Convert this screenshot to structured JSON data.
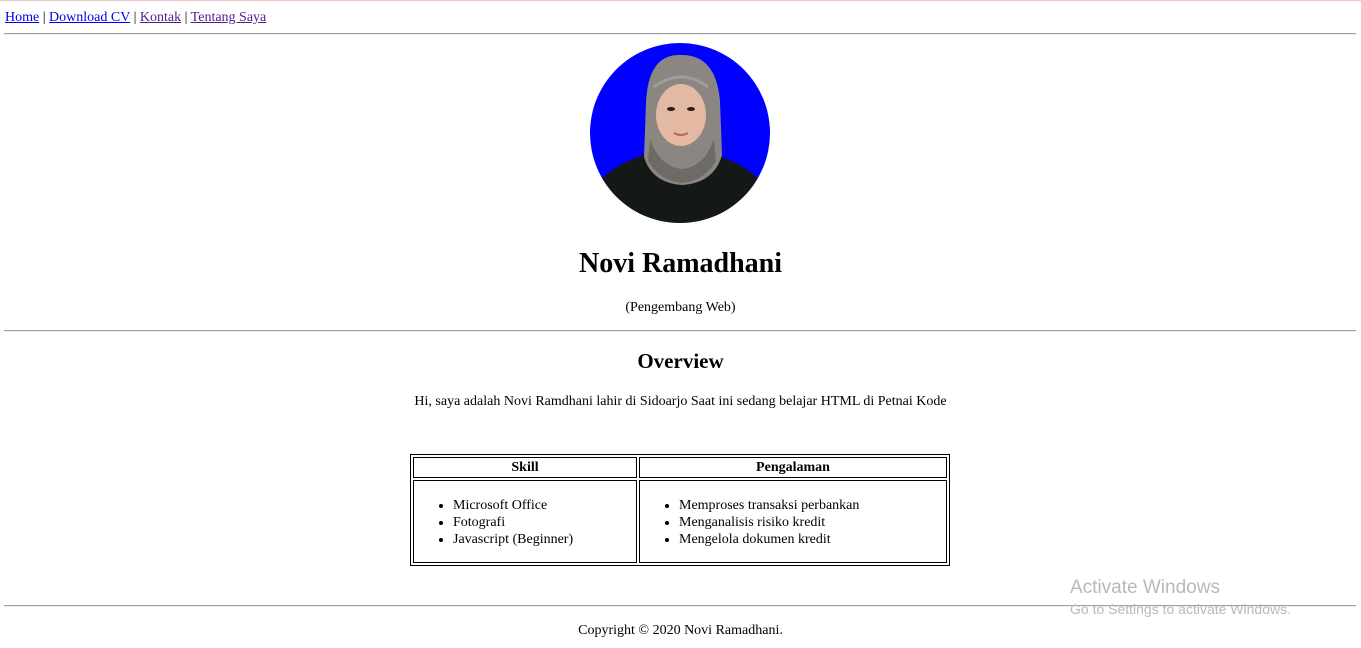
{
  "nav": {
    "links": [
      {
        "label": "Home"
      },
      {
        "label": "Download CV"
      },
      {
        "label": "Kontak"
      },
      {
        "label": "Tentang Saya"
      }
    ],
    "separator": "|"
  },
  "profile": {
    "name": "Novi Ramadhani",
    "role": "(Pengembang Web)",
    "photo_background": "#0000fe"
  },
  "overview": {
    "title": "Overview",
    "text": "Hi, saya adalah Novi Ramdhani lahir di Sidoarjo Saat ini sedang belajar HTML di Petnai Kode"
  },
  "table": {
    "headers": [
      "Skill",
      "Pengalaman"
    ],
    "skills": [
      "Microsoft Office",
      "Fotografi",
      "Javascript (Beginner)"
    ],
    "experience": [
      "Memproses transaksi perbankan",
      "Menganalisis risiko kredit",
      "Mengelola dokumen kredit"
    ]
  },
  "footer": {
    "copyright": "Copyright © 2020 Novi Ramadhani."
  },
  "os_watermark": {
    "title": "Activate Windows",
    "subtitle": "Go to Settings to activate Windows."
  }
}
